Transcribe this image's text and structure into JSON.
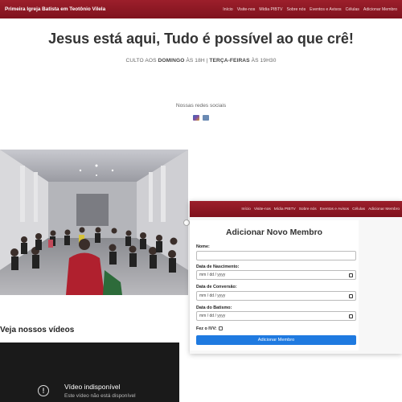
{
  "nav": {
    "brand": "Primeira Igreja Batista em Teotônio Vilela",
    "links": [
      "Início",
      "Visite-nos",
      "Mídia PIBTV",
      "Sobre nós",
      "Eventos e Avisos",
      "Células",
      "Adicionar Membro"
    ]
  },
  "hero": {
    "title": "Jesus está aqui, Tudo é possível ao que crê!",
    "sub_prefix": "CULTO AOS ",
    "sub_day1": "DOMINGO",
    "sub_mid": " ÀS 18H | ",
    "sub_day2": "TERÇA-FEIRAS",
    "sub_suffix": " ÀS 19H30"
  },
  "social": {
    "label": "Nossas redes sociais",
    "icons": [
      "instagram-icon",
      "youtube-icon"
    ]
  },
  "videos": {
    "title": "Veja nossos vídeos",
    "unavailable": "Vídeo indisponível",
    "unavailable_sub": "Este vídeo não está disponível"
  },
  "overlay": {
    "links": [
      "Início",
      "Visite-nos",
      "Mídia PIBTV",
      "Sobre nós",
      "Eventos e Avisos",
      "Células",
      "Adicionar Membro"
    ],
    "form": {
      "title": "Adicionar Novo Membro",
      "name_label": "Nome:",
      "name_value": "",
      "birth_label": "Data de Nascimento:",
      "birth_placeholder": "mm / dd / yyyy",
      "conversion_label": "Data de Conversão:",
      "conversion_placeholder": "mm / dd / yyyy",
      "baptism_label": "Data do Batismo:",
      "baptism_placeholder": "mm / dd / yyyy",
      "ivv_label": "Fez o IVV:",
      "ivv_checked": false,
      "submit_label": "Adicionar Membro"
    }
  },
  "colors": {
    "nav_bg": "#8b1a24",
    "submit_bg": "#1f7ae0"
  }
}
